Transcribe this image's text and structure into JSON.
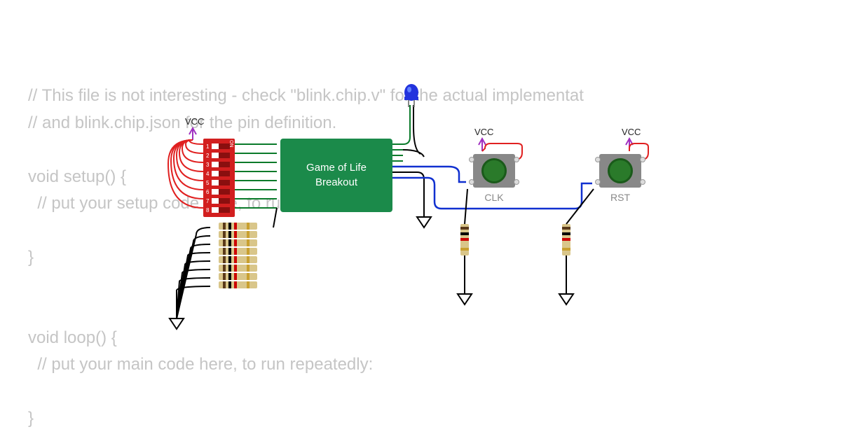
{
  "code": {
    "line1": "// This file is not interesting - check \"blink.chip.v\" for the actual implementat",
    "line2": "// and blink.chip.json for the pin definition.",
    "line3": "",
    "line4": "void setup() {",
    "line5": "  // put your setup code here, to run once:",
    "line6": "",
    "line7": "}",
    "line8": "",
    "line9": "",
    "line10": "void loop() {",
    "line11": "  // put your main code here, to run repeatedly:",
    "line12": "",
    "line13": "}"
  },
  "chip": {
    "line1": "Game of Life",
    "line2": "Breakout"
  },
  "dipswitch": {
    "on_label": "ON",
    "positions": [
      "1",
      "2",
      "3",
      "4",
      "5",
      "6",
      "7",
      "8"
    ]
  },
  "labels": {
    "vcc1": "VCC",
    "vcc2": "VCC",
    "vcc3": "VCC",
    "clk": "CLK",
    "rst": "RST"
  },
  "colors": {
    "chip": "#1b8a4a",
    "dip": "#d21f1f",
    "wire_red": "#e02020",
    "wire_green": "#0a7a2a",
    "wire_black": "#000000",
    "wire_blue": "#1030d0",
    "wire_purple": "#a030c0",
    "led": "#2233dd",
    "button": "#2a7a2a"
  }
}
